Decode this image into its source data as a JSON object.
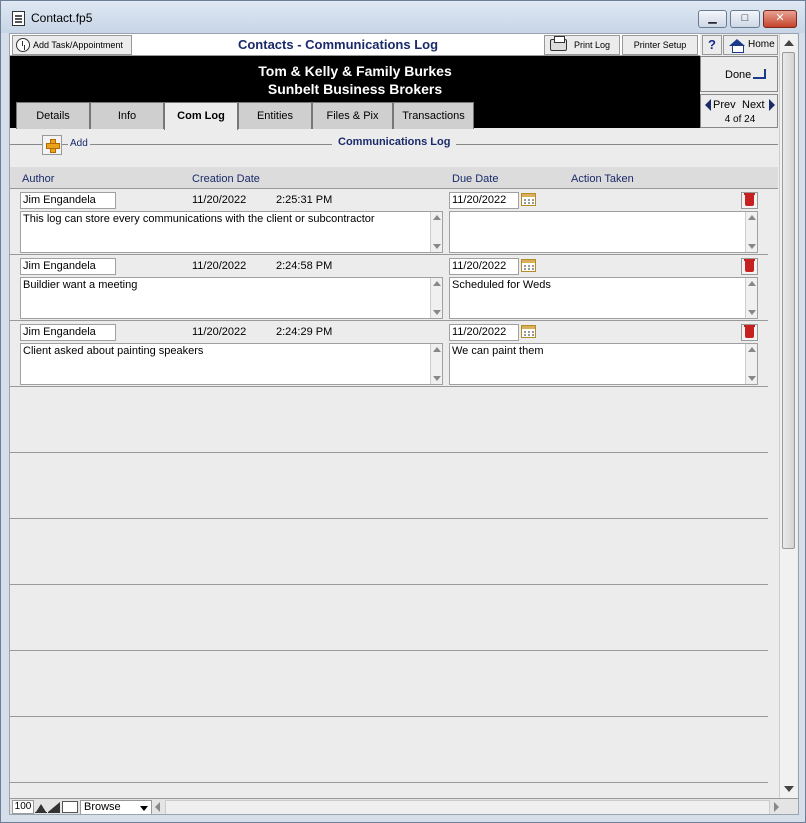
{
  "window": {
    "title": "Contact.fp5"
  },
  "toolbar": {
    "add_task_label": "Add Task/Appointment",
    "layout_title": "Contacts - Communications Log",
    "print_log_label": "Print Log",
    "printer_setup_label": "Printer Setup",
    "help_label": "?",
    "home_label": "Home"
  },
  "header": {
    "contact_name": "Tom & Kelly & Family Burkes",
    "company_name": "Sunbelt Business Brokers"
  },
  "tabs": [
    {
      "label": "Details"
    },
    {
      "label": "Info"
    },
    {
      "label": "Com Log"
    },
    {
      "label": "Entities"
    },
    {
      "label": "Files & Pix"
    },
    {
      "label": "Transactions"
    }
  ],
  "active_tab": "Com Log",
  "nav": {
    "done_label": "Done",
    "prev_label": "Prev",
    "next_label": "Next",
    "record_count": "4 of 24"
  },
  "section": {
    "add_label": "Add",
    "title": "Communications Log"
  },
  "columns": {
    "author": "Author",
    "creation_date": "Creation Date",
    "due_date": "Due Date",
    "action_taken": "Action Taken"
  },
  "log_entries": [
    {
      "author": "Jim Engandela",
      "creation_date": "11/20/2022",
      "creation_time": "2:25:31 PM",
      "due_date": "11/20/2022",
      "note": "This log can store every communications with the client or subcontractor",
      "action": ""
    },
    {
      "author": "Jim Engandela",
      "creation_date": "11/20/2022",
      "creation_time": "2:24:58 PM",
      "due_date": "11/20/2022",
      "note": "Buildier want a meeting",
      "action": "Scheduled for Weds"
    },
    {
      "author": "Jim Engandela",
      "creation_date": "11/20/2022",
      "creation_time": "2:24:29 PM",
      "due_date": "11/20/2022",
      "note": "Client asked about painting speakers",
      "action": "We can paint them"
    }
  ],
  "statusbar": {
    "zoom": "100",
    "mode": "Browse"
  }
}
